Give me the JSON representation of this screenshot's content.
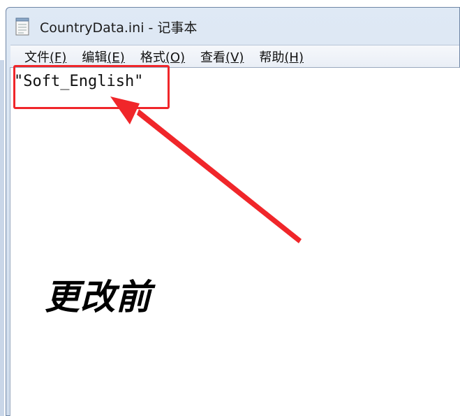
{
  "window": {
    "title": "CountryData.ini - 记事本"
  },
  "menu": [
    {
      "label": "文件",
      "accel": "(F)"
    },
    {
      "label": "编辑",
      "accel": "(E)"
    },
    {
      "label": "格式",
      "accel": "(O)"
    },
    {
      "label": "查看",
      "accel": "(V)"
    },
    {
      "label": "帮助",
      "accel": "(H)"
    }
  ],
  "editor": {
    "content": "\"Soft_English\""
  },
  "annotation": {
    "text": "更改前"
  },
  "colors": {
    "highlight": "#f0262a",
    "titlebar": "#dfe9f5"
  }
}
